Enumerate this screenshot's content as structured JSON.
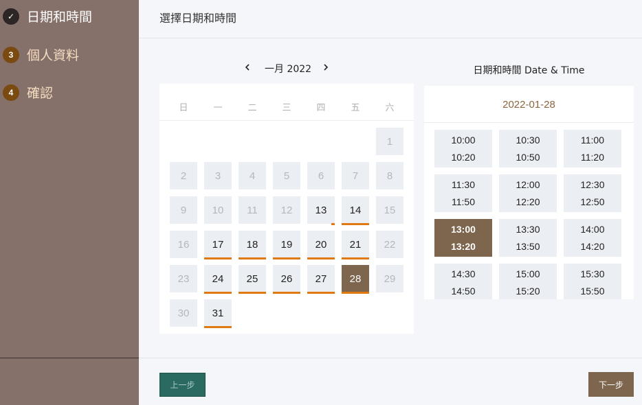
{
  "sidebar": {
    "steps": [
      {
        "number": "✓",
        "label": "日期和時間",
        "state": "done"
      },
      {
        "number": "3",
        "label": "個人資料",
        "state": "pending"
      },
      {
        "number": "4",
        "label": "確認",
        "state": "pending"
      }
    ]
  },
  "header": {
    "title": "選擇日期和時間"
  },
  "calendar": {
    "month_label": "一月 2022",
    "weekdays": [
      "日",
      "一",
      "二",
      "三",
      "四",
      "五",
      "六"
    ],
    "days": [
      {
        "d": "1",
        "available": false
      },
      {
        "d": "2",
        "available": false
      },
      {
        "d": "3",
        "available": false
      },
      {
        "d": "4",
        "available": false
      },
      {
        "d": "5",
        "available": false
      },
      {
        "d": "6",
        "available": false
      },
      {
        "d": "7",
        "available": false
      },
      {
        "d": "8",
        "available": false
      },
      {
        "d": "9",
        "available": false
      },
      {
        "d": "10",
        "available": false
      },
      {
        "d": "11",
        "available": false
      },
      {
        "d": "12",
        "available": false
      },
      {
        "d": "13",
        "available": true,
        "marker": "partial"
      },
      {
        "d": "14",
        "available": true,
        "marker": "full"
      },
      {
        "d": "15",
        "available": false
      },
      {
        "d": "16",
        "available": false
      },
      {
        "d": "17",
        "available": true,
        "marker": "full"
      },
      {
        "d": "18",
        "available": true,
        "marker": "full"
      },
      {
        "d": "19",
        "available": true,
        "marker": "full"
      },
      {
        "d": "20",
        "available": true,
        "marker": "full"
      },
      {
        "d": "21",
        "available": true,
        "marker": "full"
      },
      {
        "d": "22",
        "available": false
      },
      {
        "d": "23",
        "available": false
      },
      {
        "d": "24",
        "available": true,
        "marker": "full"
      },
      {
        "d": "25",
        "available": true,
        "marker": "full"
      },
      {
        "d": "26",
        "available": true,
        "marker": "full"
      },
      {
        "d": "27",
        "available": true,
        "marker": "full"
      },
      {
        "d": "28",
        "available": true,
        "marker": "full",
        "selected": true
      },
      {
        "d": "29",
        "available": false
      },
      {
        "d": "30",
        "available": false
      },
      {
        "d": "31",
        "available": true,
        "marker": "full"
      }
    ],
    "first_weekday_index": 6
  },
  "times": {
    "heading": "日期和時間 Date & Time",
    "selected_date": "2022-01-28",
    "slots": [
      {
        "start": "10:00",
        "end": "10:20"
      },
      {
        "start": "10:30",
        "end": "10:50"
      },
      {
        "start": "11:00",
        "end": "11:20"
      },
      {
        "start": "11:30",
        "end": "11:50"
      },
      {
        "start": "12:00",
        "end": "12:20"
      },
      {
        "start": "12:30",
        "end": "12:50"
      },
      {
        "start": "13:00",
        "end": "13:20",
        "selected": true
      },
      {
        "start": "13:30",
        "end": "13:50"
      },
      {
        "start": "14:00",
        "end": "14:20"
      },
      {
        "start": "14:30",
        "end": "14:50"
      },
      {
        "start": "15:00",
        "end": "15:20"
      },
      {
        "start": "15:30",
        "end": "15:50"
      }
    ]
  },
  "footer": {
    "prev_label": "上一步",
    "next_label": "下一步"
  },
  "colors": {
    "accent": "#7e664e",
    "marker": "#e07a10",
    "sidebar": "#85716a",
    "prev_button": "#2a6a60"
  }
}
